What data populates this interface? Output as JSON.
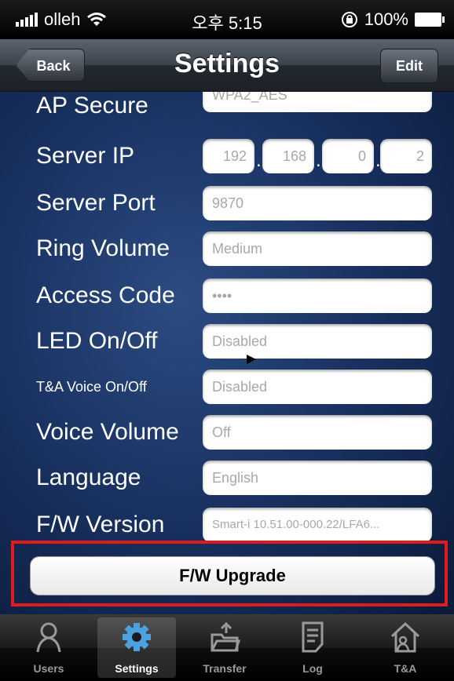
{
  "status_bar": {
    "carrier": "olleh",
    "time": "오후 5:15",
    "battery": "100%"
  },
  "nav": {
    "back_label": "Back",
    "title": "Settings",
    "edit_label": "Edit"
  },
  "settings": {
    "ap_secure": {
      "label": "AP Secure",
      "value": "WPA2_AES"
    },
    "server_ip": {
      "label": "Server IP",
      "octets": [
        "192",
        "168",
        "0",
        "2"
      ]
    },
    "server_port": {
      "label": "Server Port",
      "value": "9870"
    },
    "ring_volume": {
      "label": "Ring Volume",
      "value": "Medium"
    },
    "access_code": {
      "label": "Access Code",
      "value": "••••"
    },
    "led": {
      "label": "LED On/Off",
      "value": "Disabled"
    },
    "ta_voice": {
      "label": "T&A Voice On/Off",
      "value": "Disabled"
    },
    "voice_volume": {
      "label": "Voice Volume",
      "value": "Off"
    },
    "language": {
      "label": "Language",
      "value": "English"
    },
    "fw_version": {
      "label": "F/W Version",
      "value": "Smart-i 10.51.00-000.22/LFA6..."
    }
  },
  "upgrade": {
    "label": "F/W Upgrade"
  },
  "tabs": [
    {
      "label": "Users",
      "icon": "users-icon",
      "active": false
    },
    {
      "label": "Settings",
      "icon": "gear-icon",
      "active": true
    },
    {
      "label": "Transfer",
      "icon": "transfer-icon",
      "active": false
    },
    {
      "label": "Log",
      "icon": "log-icon",
      "active": false
    },
    {
      "label": "T&A",
      "icon": "home-person-icon",
      "active": false
    }
  ],
  "colors": {
    "highlight_border": "#e11a1a",
    "gear_active": "#4aa3e0"
  }
}
